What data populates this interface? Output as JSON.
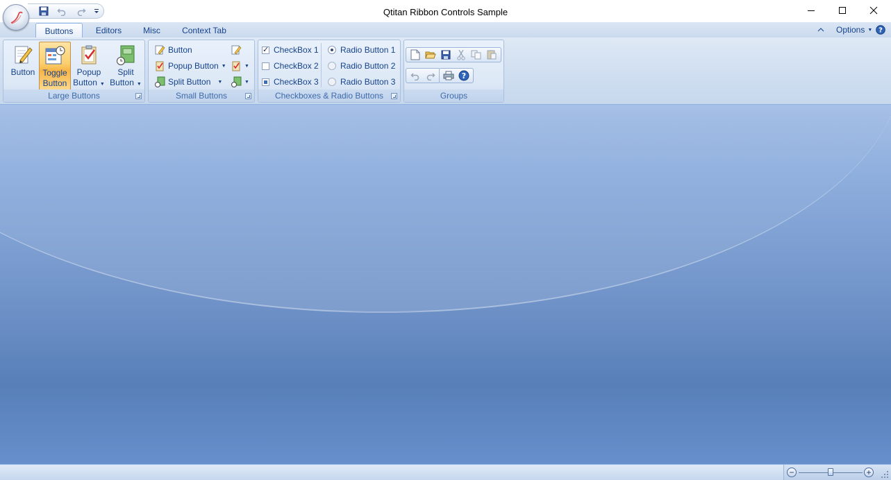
{
  "window": {
    "title": "Qtitan Ribbon Controls Sample",
    "minimize_icon": "minimize-icon",
    "maximize_icon": "maximize-icon",
    "close_icon": "close-icon"
  },
  "quick_access": {
    "items": [
      "save-icon",
      "undo-icon",
      "redo-icon",
      "customize-icon"
    ]
  },
  "tabs": [
    {
      "label": "Buttons",
      "active": true
    },
    {
      "label": "Editors",
      "active": false
    },
    {
      "label": "Misc",
      "active": false
    },
    {
      "label": "Context Tab",
      "active": false
    }
  ],
  "tabrow_right": {
    "options_label": "Options",
    "help_icon": "help-icon",
    "collapse_icon": "collapse-ribbon-icon"
  },
  "groups": {
    "large_buttons": {
      "caption": "Large Buttons",
      "button": {
        "line1": "Button",
        "line2": ""
      },
      "toggle": {
        "line1": "Toggle",
        "line2": "Button"
      },
      "popup": {
        "line1": "Popup",
        "line2": "Button"
      },
      "split": {
        "line1": "Split",
        "line2": "Button"
      }
    },
    "small_buttons": {
      "caption": "Small Buttons",
      "button": "Button",
      "popup": "Popup Button",
      "split": "Split Button"
    },
    "checks_radios": {
      "caption": "Checkboxes & Radio Buttons",
      "checkbox1": "CheckBox 1",
      "checkbox2": "CheckBox 2",
      "checkbox3": "CheckBox 3",
      "radio1": "Radio Button 1",
      "radio2": "Radio Button 2",
      "radio3": "Radio Button 3"
    },
    "groups": {
      "caption": "Groups"
    }
  },
  "colors": {
    "accent": "#15428b",
    "ribbon_border": "#8db2e3",
    "workspace_top": "#a6c0e6",
    "workspace_bottom": "#587fb8"
  },
  "statusbar": {
    "zoom_out_glyph": "−",
    "zoom_in_glyph": "+",
    "zoom_level": 0.5
  }
}
